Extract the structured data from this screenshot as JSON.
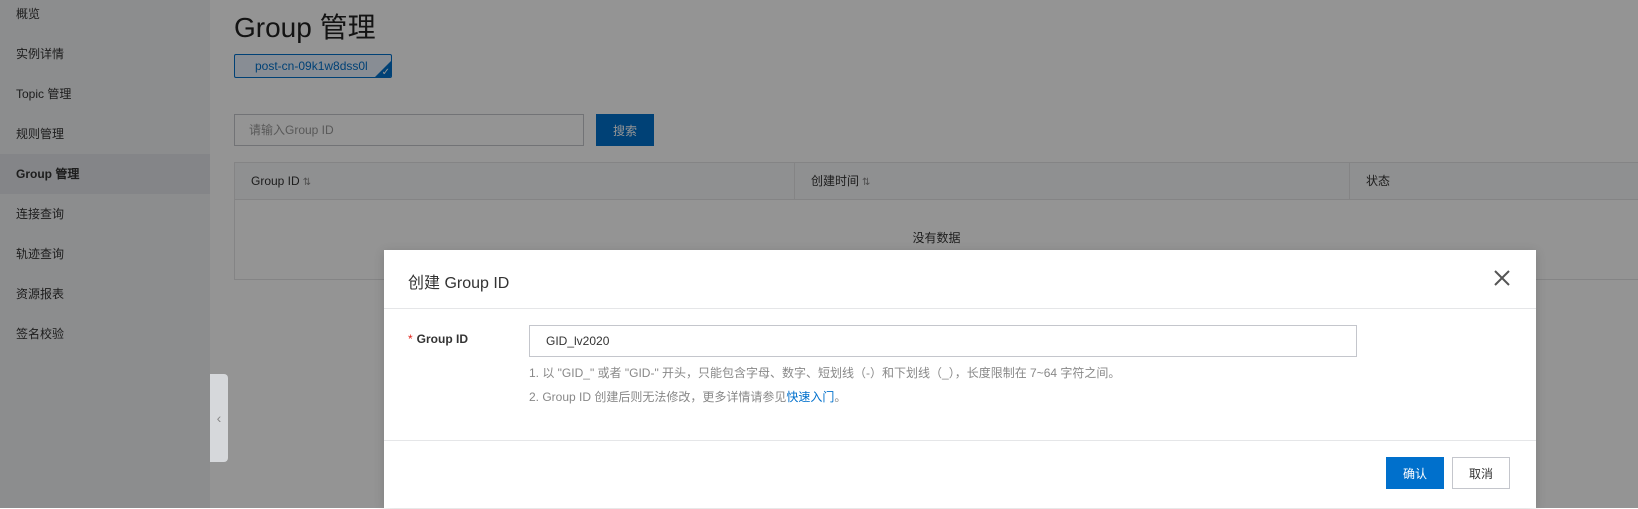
{
  "sidebar": {
    "items": [
      {
        "label": "概览",
        "active": false
      },
      {
        "label": "实例详情",
        "active": false
      },
      {
        "label": "Topic 管理",
        "active": false
      },
      {
        "label": "规则管理",
        "active": false
      },
      {
        "label": "Group 管理",
        "active": true
      },
      {
        "label": "连接查询",
        "active": false
      },
      {
        "label": "轨迹查询",
        "active": false
      },
      {
        "label": "资源报表",
        "active": false
      },
      {
        "label": "签名校验",
        "active": false
      }
    ]
  },
  "main": {
    "title": "Group 管理",
    "instance_tag": "post-cn-09k1w8dss0l",
    "search": {
      "placeholder": "请输入Group ID",
      "button_label": "搜索"
    },
    "table": {
      "columns": [
        "Group ID",
        "创建时间",
        "状态"
      ],
      "empty_text": "没有数据"
    }
  },
  "dialog": {
    "title": "创建 Group ID",
    "field_label": "Group ID",
    "required_mark": "*",
    "field_value": "GID_lv2020",
    "hint1": "1. 以 \"GID_\" 或者 \"GID-\" 开头，只能包含字母、数字、短划线（-）和下划线（_），长度限制在 7~64 字符之间。",
    "hint2_prefix": "2. Group ID 创建后则无法修改，更多详情请参见",
    "hint2_link": "快速入门",
    "hint2_suffix": "。",
    "ok_label": "确认",
    "cancel_label": "取消"
  },
  "colors": {
    "primary": "#0070cc",
    "required": "#e2231a",
    "mask": "rgba(0,0,0,0.42)"
  }
}
